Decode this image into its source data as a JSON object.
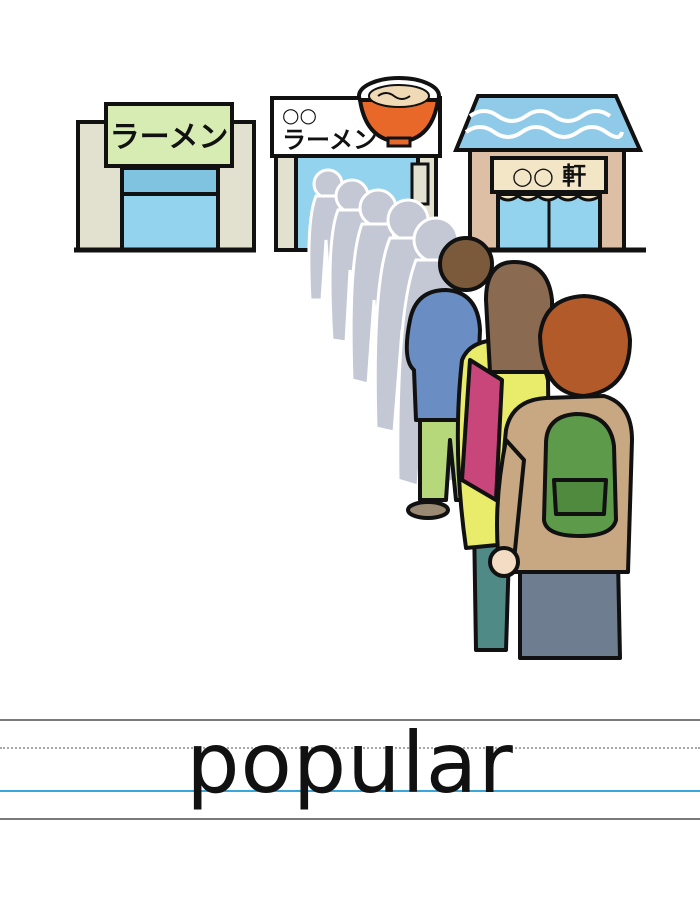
{
  "word": "popular",
  "shops": {
    "left_sign": "ラーメン",
    "middle_sign_line1": "○○",
    "middle_sign_line2": "ラーメン",
    "right_sign": "○○ 軒"
  },
  "colors": {
    "sign_green": "#d7ecb2",
    "window_blue": "#93d3ee",
    "roof_blue": "#8fcbe8",
    "bowl_orange": "#e8682a",
    "shadow_gray": "#c4c8d4",
    "baseline_blue": "#39a6dc"
  }
}
